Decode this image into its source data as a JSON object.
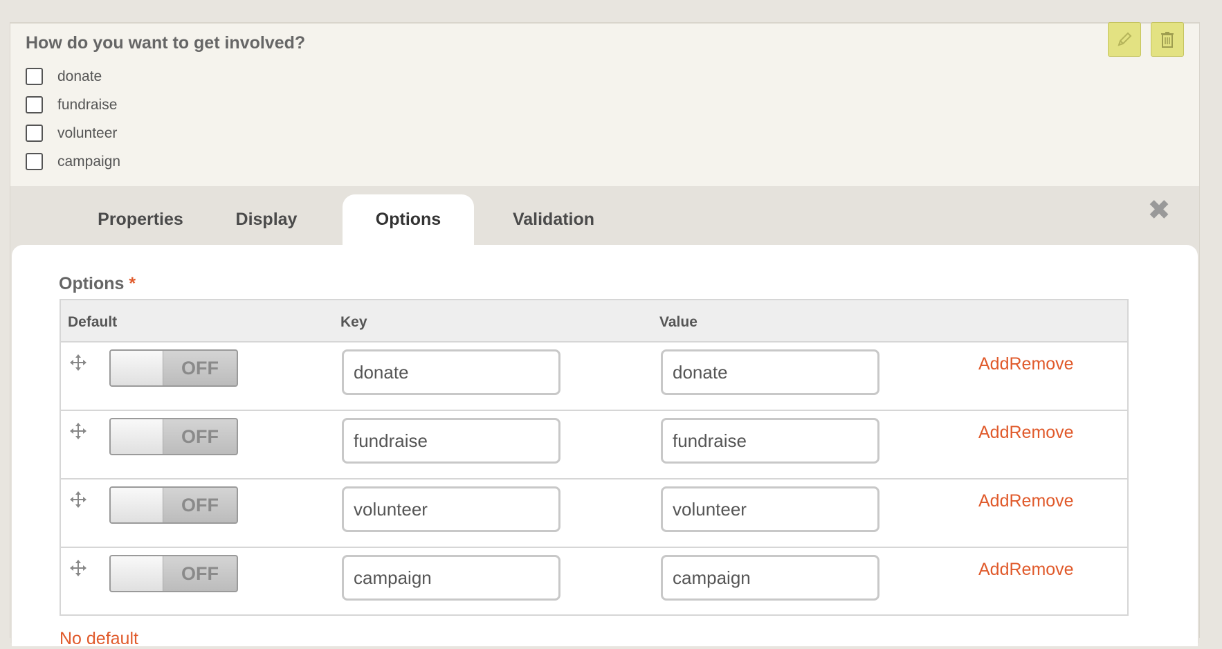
{
  "field": {
    "title": "How do you want to get involved?",
    "options": [
      "donate",
      "fundraise",
      "volunteer",
      "campaign"
    ]
  },
  "toolbar": {
    "edit_icon": "pencil-icon",
    "delete_icon": "trash-icon"
  },
  "tabs": [
    {
      "label": "Properties",
      "active": false
    },
    {
      "label": "Display",
      "active": false
    },
    {
      "label": "Options",
      "active": true
    },
    {
      "label": "Validation",
      "active": false
    }
  ],
  "close_symbol": "✖",
  "options_panel": {
    "heading": "Options",
    "required_mark": "*",
    "columns": {
      "default": "Default",
      "key": "Key",
      "value": "Value"
    },
    "rows": [
      {
        "toggle": "OFF",
        "key": "donate",
        "value": "donate"
      },
      {
        "toggle": "OFF",
        "key": "fundraise",
        "value": "fundraise"
      },
      {
        "toggle": "OFF",
        "key": "volunteer",
        "value": "volunteer"
      },
      {
        "toggle": "OFF",
        "key": "campaign",
        "value": "campaign"
      }
    ],
    "add_label": "Add",
    "remove_label": "Remove",
    "no_default_link": "No default"
  },
  "colors": {
    "accent": "#e05a2b",
    "tool_button": "#e3e282",
    "panel_bg": "#f5f3ed"
  }
}
